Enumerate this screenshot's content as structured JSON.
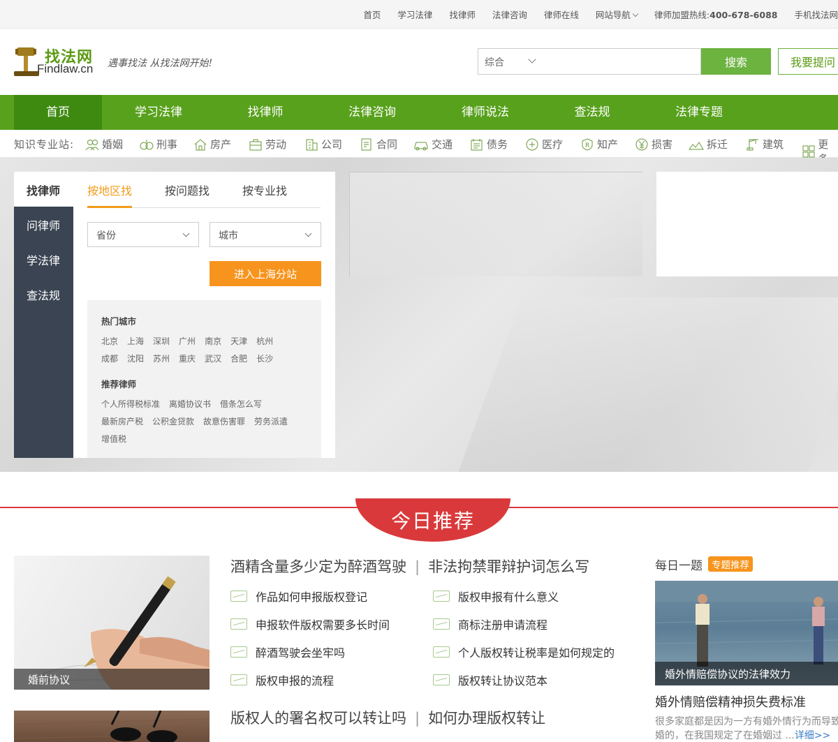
{
  "topbar": {
    "links": [
      "首页",
      "学习法律",
      "找律师",
      "法律咨询",
      "律师在线",
      "网站导航"
    ],
    "hotline_label": "律师加盟热线:",
    "hotline_number": "400-678-6088",
    "mobile": "手机找法网"
  },
  "header": {
    "logo_cn": "找法网",
    "logo_en": "Findlaw.cn",
    "slogan": "遇事找法  从找法网开始!",
    "search_select": "综合",
    "search_button": "搜索",
    "ask_button": "我要提问"
  },
  "nav": [
    "首页",
    "学习法律",
    "找律师",
    "法律咨询",
    "律师说法",
    "查法规",
    "法律专题"
  ],
  "kbar": {
    "label": "知识专业站:",
    "items": [
      "婚姻",
      "刑事",
      "房产",
      "劳动",
      "公司",
      "合同",
      "交通",
      "债务",
      "医疗",
      "知产",
      "损害",
      "拆迁",
      "建筑",
      "更多"
    ]
  },
  "finder": {
    "side_title": "找律师",
    "side_items": [
      "问律师",
      "学法律",
      "查法规"
    ],
    "tabs": [
      "按地区找",
      "按问题找",
      "按专业找"
    ],
    "province": "省份",
    "city": "城市",
    "enter_button": "进入上海分站",
    "hot_cities_title": "热门城市",
    "hot_cities_row1": [
      "北京",
      "上海",
      "深圳",
      "广州",
      "南京",
      "天津",
      "杭州"
    ],
    "hot_cities_row2": [
      "成都",
      "沈阳",
      "苏州",
      "重庆",
      "武汉",
      "合肥",
      "长沙"
    ],
    "recommend_title": "推荐律师",
    "recommend_row1": [
      "个人所得税标准",
      "离婚协议书",
      "借条怎么写"
    ],
    "recommend_row2": [
      "最新房产税",
      "公积金贷款",
      "故意伤害罪",
      "劳务派遣"
    ],
    "recommend_row3": [
      "增值税"
    ]
  },
  "today": {
    "title": "今日推荐",
    "image1_caption": "婚前协议",
    "headline1_a": "酒精含量多少定为醉酒驾驶",
    "headline1_b": "非法拘禁罪辩护词怎么写",
    "articles_left": [
      "作品如何申报版权登记",
      "申报软件版权需要多长时间",
      "醉酒驾驶会坐牢吗",
      "版权申报的流程"
    ],
    "articles_right": [
      "版权申报有什么意义",
      "商标注册申请流程",
      "个人版权转让税率是如何规定的",
      "版权转让协议范本"
    ],
    "headline2_a": "版权人的署名权可以转让吗",
    "headline2_b": "如何办理版权转让"
  },
  "daily": {
    "title": "每日一题",
    "badge": "专题推荐",
    "image_caption": "婚外情赔偿协议的法律效力",
    "headline": "婚外情赔偿精神损失费标准",
    "summary": "很多家庭都是因为一方有婚外情行为而导致离婚的，在我国规定了在婚姻过 ...",
    "more": "详细>>"
  },
  "colors": {
    "nav_green": "#58a11c",
    "nav_active": "#3e8a10",
    "search_green": "#6cb33f",
    "orange": "#f7941d",
    "red": "#d9393b",
    "sidebar_dark": "#3a4452"
  }
}
